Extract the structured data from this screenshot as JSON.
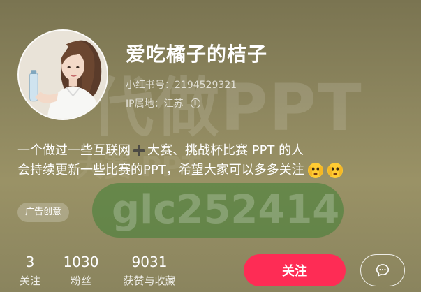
{
  "profile": {
    "nickname": "爱吃橘子的桔子",
    "account_id": "小红书号：2194529321",
    "ip_location": "IP属地：江苏"
  },
  "bio": {
    "line1_part1": "一个做过一些互联网",
    "line1_icon": "heavy-plus-icon",
    "line1_part2": "大赛、挑战杯比赛 PPT 的人",
    "line2": "会持续更新一些比赛的PPT，希望大家可以多多关注",
    "line2_emoji": "peeking-eyes-emoji"
  },
  "tag": {
    "label": "广告创意"
  },
  "stats": {
    "following": {
      "value": "3",
      "label": "关注"
    },
    "followers": {
      "value": "1030",
      "label": "粉丝"
    },
    "likes": {
      "value": "9031",
      "label": "获赞与收藏"
    }
  },
  "actions": {
    "follow_label": "关注",
    "message_icon": "chat-bubble-icon"
  },
  "background_watermark": {
    "line1": "代做PPT",
    "line2": "大赛 PPT",
    "line3": "glc252414"
  },
  "colors": {
    "follow_button": "#fe2c55",
    "background": "#8e875f"
  }
}
